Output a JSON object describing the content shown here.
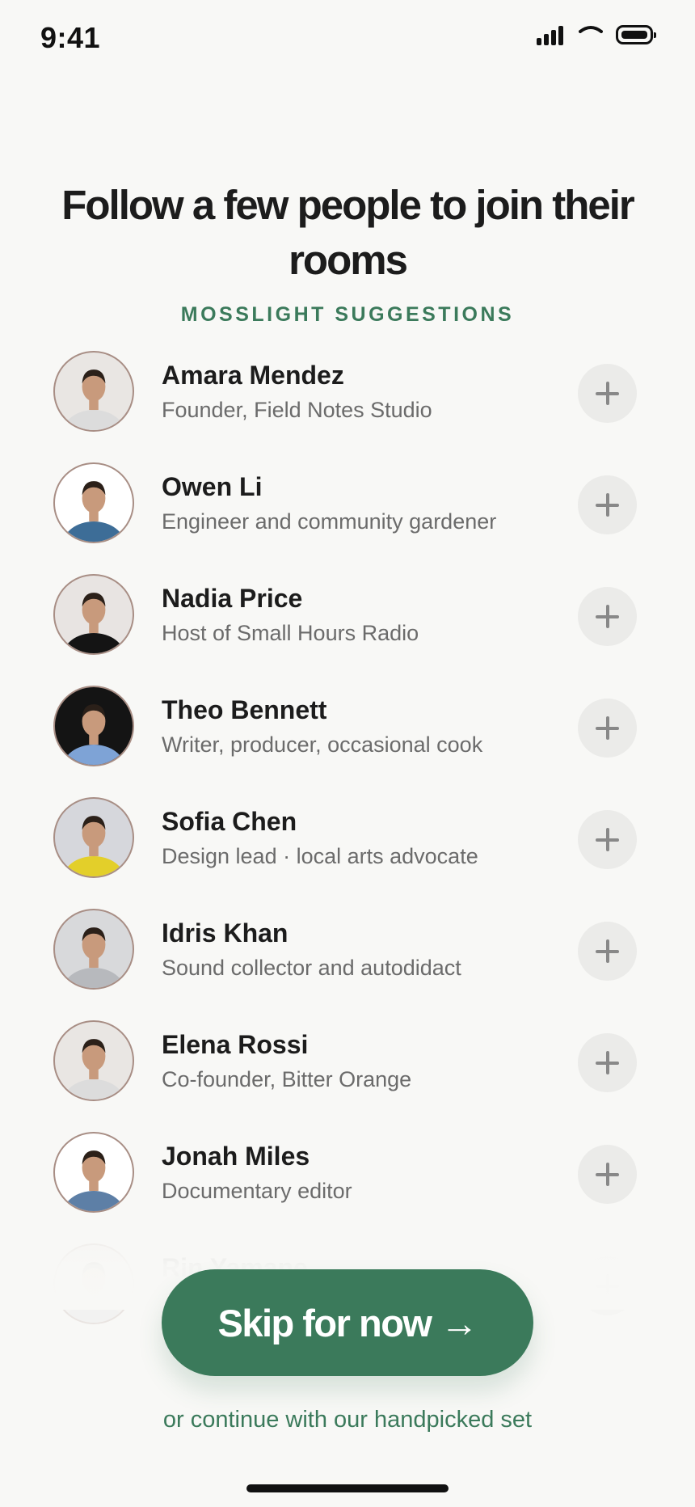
{
  "status_bar": {
    "time": "9:41",
    "icons": [
      "cellular-signal-icon",
      "wifi-icon",
      "battery-icon"
    ]
  },
  "header": {
    "title": "Follow a few people to join their rooms",
    "subtitle": "MOSSLIGHT SUGGESTIONS"
  },
  "people": [
    {
      "name": "Amara Mendez",
      "bio": "Founder, Field Notes Studio",
      "avatar_bg": "#e9e6e3",
      "avatar_shirt": "#dcdcdc"
    },
    {
      "name": "Owen Li",
      "bio": "Engineer and community gardener",
      "avatar_bg": "#ffffff",
      "avatar_shirt": "#3d6d97"
    },
    {
      "name": "Nadia Price",
      "bio": "Host of Small Hours Radio",
      "avatar_bg": "#e8e4e2",
      "avatar_shirt": "#141414"
    },
    {
      "name": "Theo Bennett",
      "bio": "Writer, producer, occasional cook",
      "avatar_bg": "#141414",
      "avatar_shirt": "#7ea3d6"
    },
    {
      "name": "Sofia Chen",
      "bio": "Design lead · local arts advocate",
      "avatar_bg": "#d6d7dc",
      "avatar_shirt": "#e3cf2a"
    },
    {
      "name": "Idris Khan",
      "bio": "Sound collector and autodidact",
      "avatar_bg": "#d8d9db",
      "avatar_shirt": "#b7b9bd"
    },
    {
      "name": "Elena Rossi",
      "bio": "Co-founder, Bitter Orange",
      "avatar_bg": "#e9e6e3",
      "avatar_shirt": "#dcdcdc"
    },
    {
      "name": "Jonah Miles",
      "bio": "Documentary editor",
      "avatar_bg": "#ffffff",
      "avatar_shirt": "#5d7fa6"
    },
    {
      "name": "Rin Yamane",
      "bio": "",
      "avatar_bg": "#e9e6e3",
      "avatar_shirt": "#dcdcdc"
    }
  ],
  "follow_icon": "plus-icon",
  "actions": {
    "skip_label": "Skip for now →",
    "alt_link": "or continue with our handpicked set"
  },
  "colors": {
    "accent": "#3b7a5b",
    "background": "#f8f8f6",
    "follow_button_bg": "#ebebe9"
  }
}
